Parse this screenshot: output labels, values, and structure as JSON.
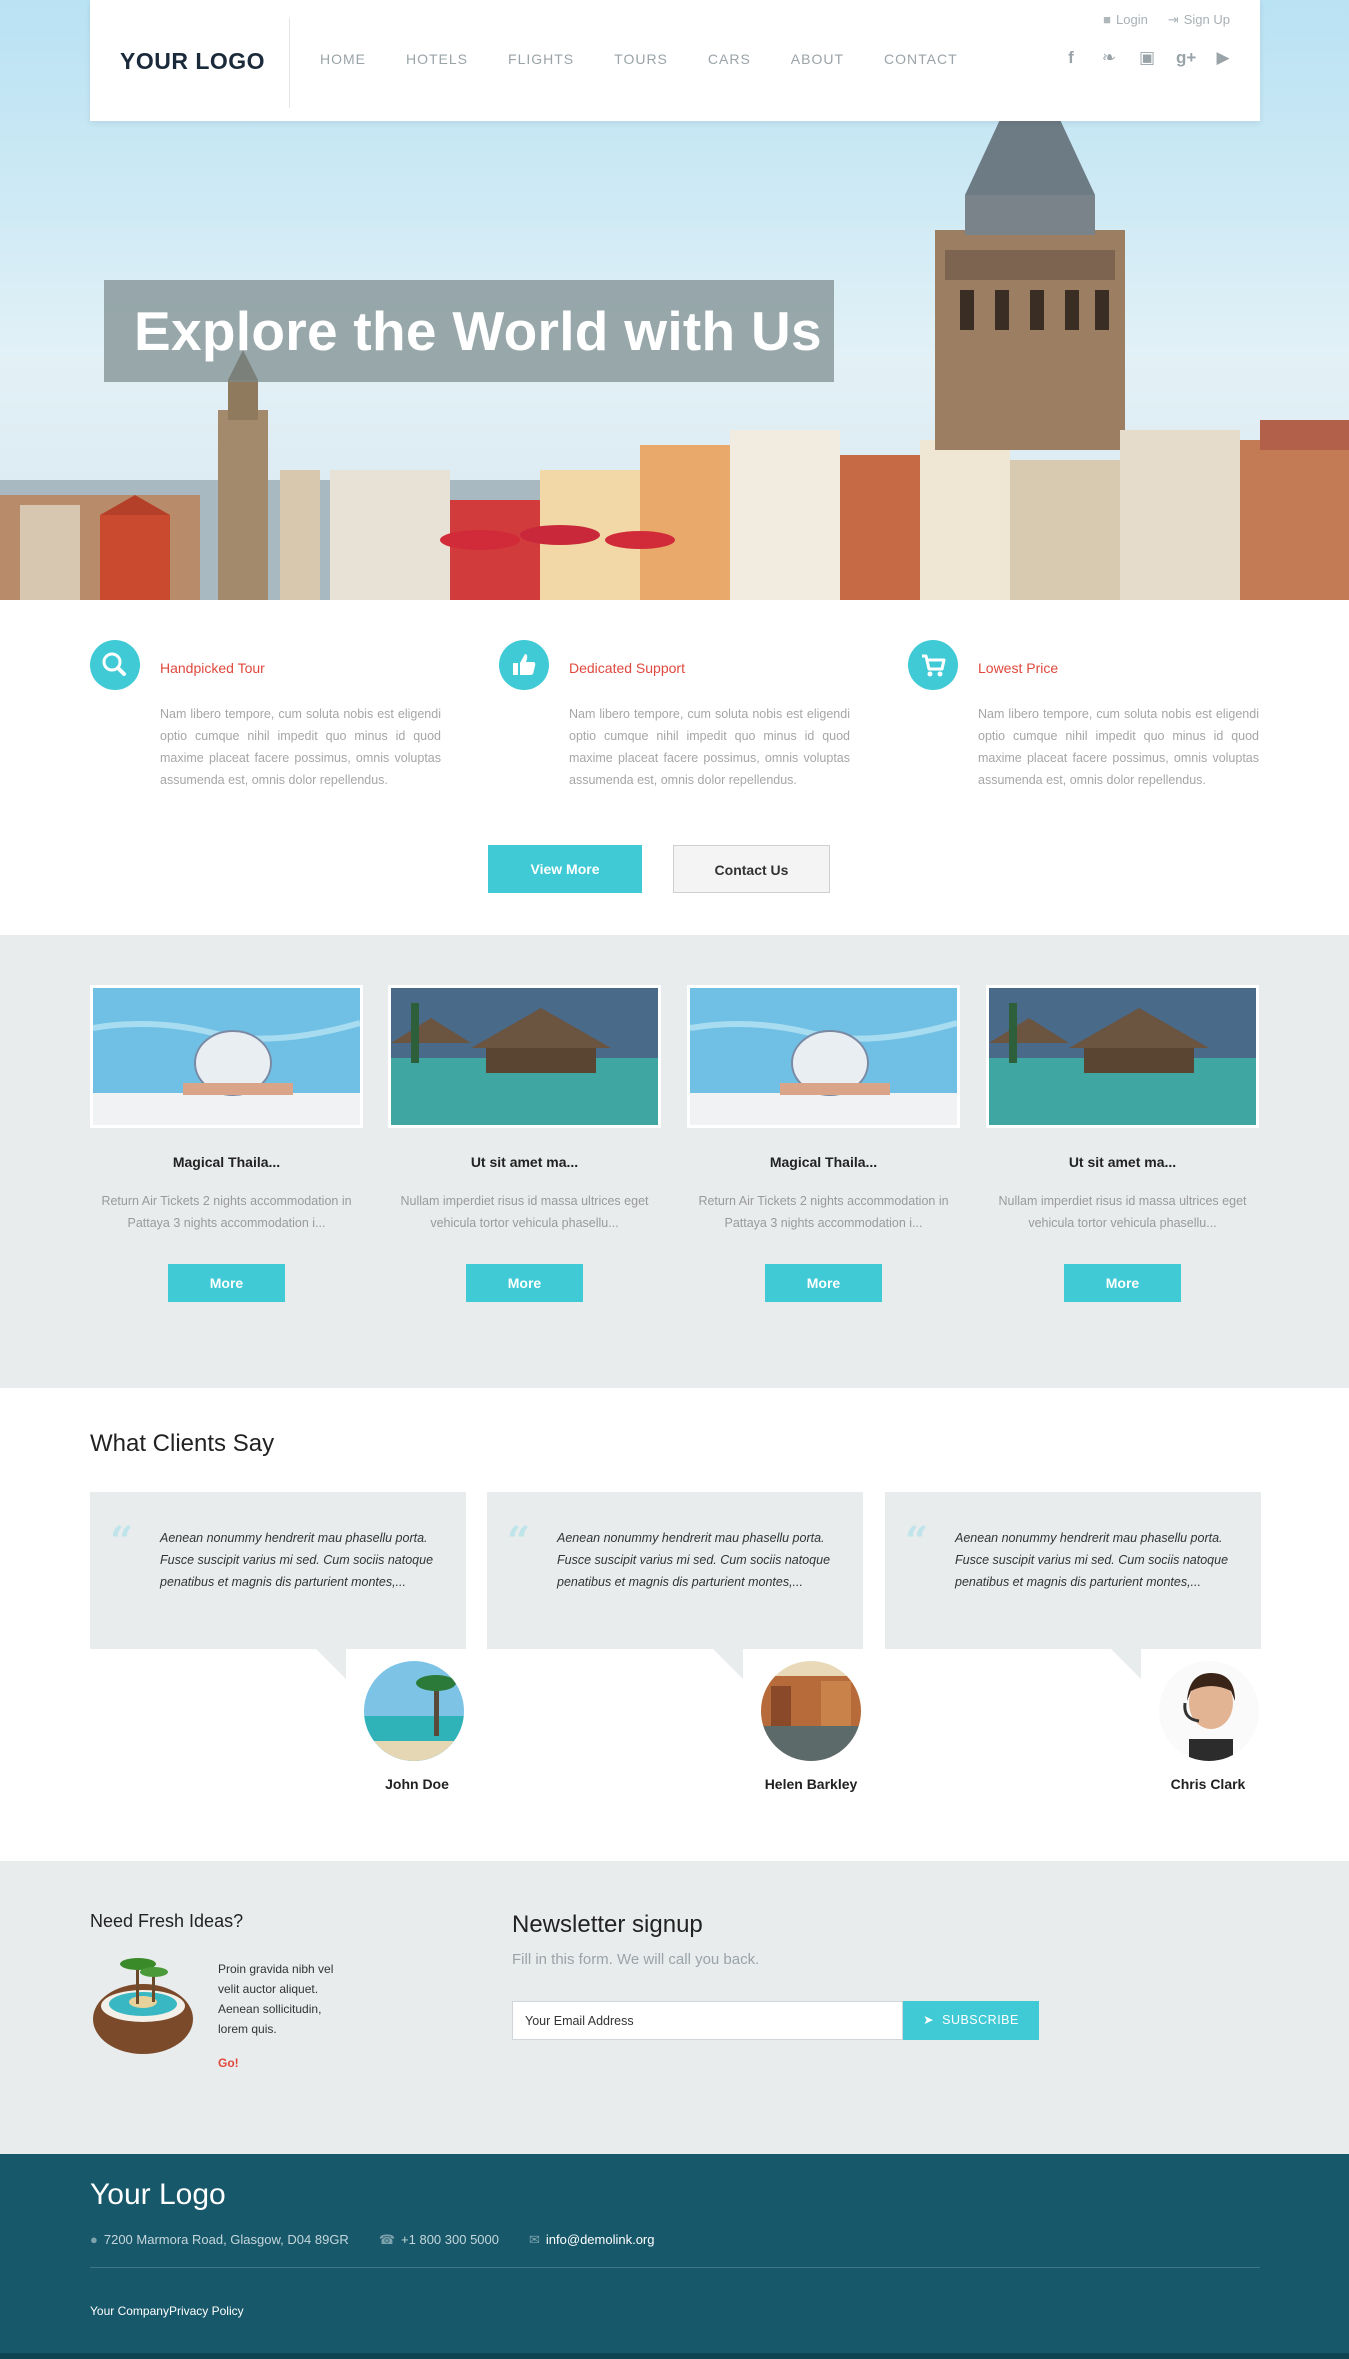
{
  "header": {
    "logo": "YOUR LOGO",
    "nav": [
      "HOME",
      "HOTELS",
      "FLIGHTS",
      "TOURS",
      "CARS",
      "ABOUT",
      "CONTACT"
    ],
    "login": "Login",
    "signup": "Sign Up",
    "social_icons": [
      "facebook-icon",
      "twitter-icon",
      "instagram-icon",
      "google-plus-icon",
      "youtube-icon"
    ]
  },
  "hero": {
    "title": "Explore the World with Us"
  },
  "features": [
    {
      "icon": "search-icon",
      "title": "Handpicked Tour",
      "text": "Nam libero tempore, cum soluta nobis est eligendi optio cumque nihil impedit quo minus id quod maxime placeat facere possimus, omnis voluptas assumenda est, omnis dolor repellendus."
    },
    {
      "icon": "thumbs-up-icon",
      "title": "Dedicated Support",
      "text": "Nam libero tempore, cum soluta nobis est eligendi optio cumque nihil impedit quo minus id quod maxime placeat facere possimus, omnis voluptas assumenda est, omnis dolor repellendus."
    },
    {
      "icon": "cart-icon",
      "title": "Lowest Price",
      "text": "Nam libero tempore, cum soluta nobis est eligendi optio cumque nihil impedit quo minus id quod maxime placeat facere possimus, omnis voluptas assumenda est, omnis dolor repellendus."
    }
  ],
  "buttons": {
    "view_more": "View More",
    "contact_us": "Contact Us"
  },
  "tours": [
    {
      "title": "Magical Thaila...",
      "desc": "Return Air Tickets 2 nights accommodation in Pattaya 3 nights accommodation i...",
      "button": "More"
    },
    {
      "title": "Ut sit amet ma...",
      "desc": "Nullam imperdiet risus id massa ultrices eget vehicula tortor vehicula phasellu...",
      "button": "More"
    },
    {
      "title": "Magical Thaila...",
      "desc": "Return Air Tickets 2 nights accommodation in Pattaya 3 nights accommodation i...",
      "button": "More"
    },
    {
      "title": "Ut sit amet ma...",
      "desc": "Nullam imperdiet risus id massa ultrices eget vehicula tortor vehicula phasellu...",
      "button": "More"
    }
  ],
  "clients": {
    "heading": "What Clients Say",
    "items": [
      {
        "quote": "Aenean nonummy hendrerit mau phasellu porta. Fusce suscipit varius mi sed. Cum sociis natoque penatibus et magnis dis parturient montes,...",
        "name": "John Doe"
      },
      {
        "quote": "Aenean nonummy hendrerit mau phasellu porta. Fusce suscipit varius mi sed. Cum sociis natoque penatibus et magnis dis parturient montes,...",
        "name": "Helen Barkley"
      },
      {
        "quote": "Aenean nonummy hendrerit mau phasellu porta. Fusce suscipit varius mi sed. Cum sociis natoque penatibus et magnis dis parturient montes,...",
        "name": "Chris Clark"
      }
    ]
  },
  "newsletter": {
    "ideas_title": "Need Fresh Ideas?",
    "ideas_text": "Proin gravida nibh vel velit auctor aliquet. Aenean sollicitudin, lorem quis.",
    "go": "Go!",
    "title": "Newsletter signup",
    "subtitle": "Fill in this form. We will call you back.",
    "email_value": "Your Email Address",
    "subscribe": "SUBSCRIBE"
  },
  "footer": {
    "logo": "Your Logo",
    "address": "7200 Marmora Road, Glasgow, D04 89GR",
    "phone": "+1 800 300 5000",
    "email": "info@demolink.org",
    "copyright": "Your CompanyPrivacy Policy"
  },
  "colors": {
    "accent": "#3fcad6",
    "red": "#e0483d",
    "footer": "#17586a"
  }
}
